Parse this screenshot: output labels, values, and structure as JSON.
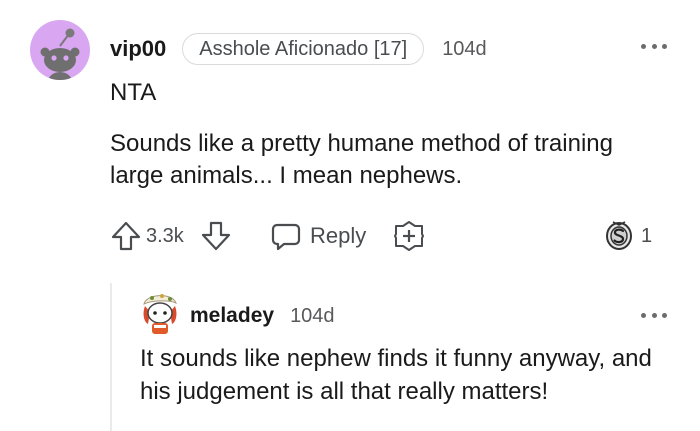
{
  "comment": {
    "username": "vip00",
    "flair": "Asshole Aficionado [17]",
    "time": "104d",
    "lines": [
      "NTA"
    ],
    "paragraph": "Sounds like a pretty humane method of training large animals... I mean nephews.",
    "score": "3.3k",
    "reply_label": "Reply",
    "award_count": "1",
    "avatar_color": "#d9a6f2"
  },
  "reply": {
    "username": "meladey",
    "time": "104d",
    "text": "It sounds like nephew finds it funny anyway, and his judgement is all that really matters!"
  },
  "icons": [
    "snoo-avatar-icon",
    "more-options-icon",
    "upvote-icon",
    "downvote-icon",
    "reply-bubble-icon",
    "add-award-icon",
    "silver-award-icon",
    "user-avatar-icon"
  ]
}
